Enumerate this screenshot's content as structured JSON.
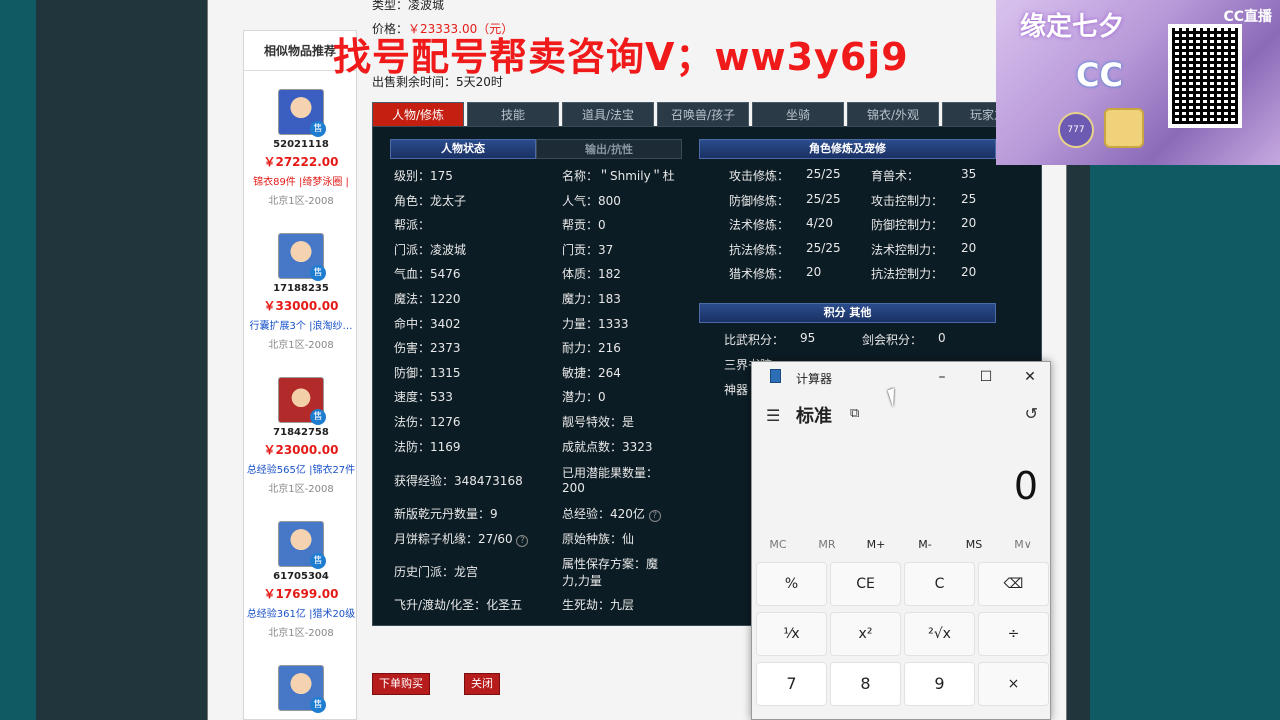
{
  "header": {
    "type_label": "类型：",
    "type_value": "凌波城",
    "price_label": "价格：",
    "price_value": "￥23333.00（元）",
    "time_label": "出售剩余时间：",
    "time_value": "5天20时",
    "watermark": "找号配号帮卖咨询V；ww3y6j9"
  },
  "recommend": {
    "title": "相似物品推荐",
    "sell_tag": "售",
    "items": [
      {
        "id": "52021118",
        "price": "￥27222.00",
        "desc": "锦衣89件 |绮梦泳圈 |",
        "server": "北京1区-2008"
      },
      {
        "id": "17188235",
        "price": "￥33000.00",
        "desc": "行囊扩展3个 |浪淘纱…",
        "server": "北京1区-2008"
      },
      {
        "id": "71842758",
        "price": "￥23000.00",
        "desc": "总经验565亿 |锦衣27件",
        "server": "北京1区-2008"
      },
      {
        "id": "61705304",
        "price": "￥17699.00",
        "desc": "总经验361亿 |猎术20级",
        "server": "北京1区-2008"
      }
    ]
  },
  "tabs": [
    "人物/修炼",
    "技能",
    "道具/法宝",
    "召唤兽/孩子",
    "坐骑",
    "锦衣/外观",
    "玩家之"
  ],
  "panel": {
    "status_header": "人物状态",
    "output_header": "输出/抗性",
    "cultivation_header": "角色修炼及宠修",
    "score_header": "积分 其他",
    "left_col": [
      "级别：175",
      "角色：龙太子",
      "帮派：",
      "门派：凌波城",
      "气血：5476",
      "魔法：1220",
      "命中：3402",
      "伤害：2373",
      "防御：1315",
      "速度：533",
      "法伤：1276",
      "法防：1169"
    ],
    "mid_col": [
      "名称：＂Shmily＂杜",
      "人气：800",
      "帮贡：0",
      "门贡：37",
      "体质：182",
      "魔力：183",
      "力量：1333",
      "耐力：216",
      "敏捷：264",
      "潜力：0",
      "靓号特效：是",
      "成就点数：3323"
    ],
    "extra_left": [
      "获得经验：348473168",
      "新版乾元丹数量：9",
      "月饼粽子机缘：27/60",
      "历史门派：龙宫",
      "飞升/渡劫/化圣：化圣五"
    ],
    "extra_mid": [
      "已用潜能果数量：",
      "200",
      "总经验：420亿",
      "原始种族：仙",
      "属性保存方案：魔",
      "力,力量",
      "生死劫：九层"
    ],
    "cultivation": [
      [
        "攻击修炼：",
        "25/25",
        "育兽术：",
        "35"
      ],
      [
        "防御修炼：",
        "25/25",
        "攻击控制力：",
        "25"
      ],
      [
        "法术修炼：",
        "4/20",
        "防御控制力：",
        "20"
      ],
      [
        "抗法修炼：",
        "25/25",
        "法术控制力：",
        "20"
      ],
      [
        "猎术修炼：",
        "20",
        "抗法控制力：",
        "20"
      ]
    ],
    "scores": [
      [
        "比武积分：",
        "95",
        "剑会积分：",
        "0"
      ],
      [
        "三界书院：",
        "",
        "",
        ""
      ],
      [
        "神器",
        "",
        "",
        ""
      ]
    ]
  },
  "buttons": {
    "buy": "下单购买",
    "close": "关闭"
  },
  "promo": {
    "title": "缘定七夕",
    "brand": "CC",
    "top_label": "CC直播",
    "badge": "777"
  },
  "calculator": {
    "title": "计算器",
    "mode": "标准",
    "display": "0",
    "memory": [
      "MC",
      "MR",
      "M+",
      "M-",
      "MS",
      "M∨"
    ],
    "row1": [
      "%",
      "CE",
      "C",
      "⌫"
    ],
    "row2": [
      "¹⁄x",
      "x²",
      "²√x",
      "÷"
    ],
    "row3": [
      "7",
      "8",
      "9",
      "×"
    ]
  }
}
